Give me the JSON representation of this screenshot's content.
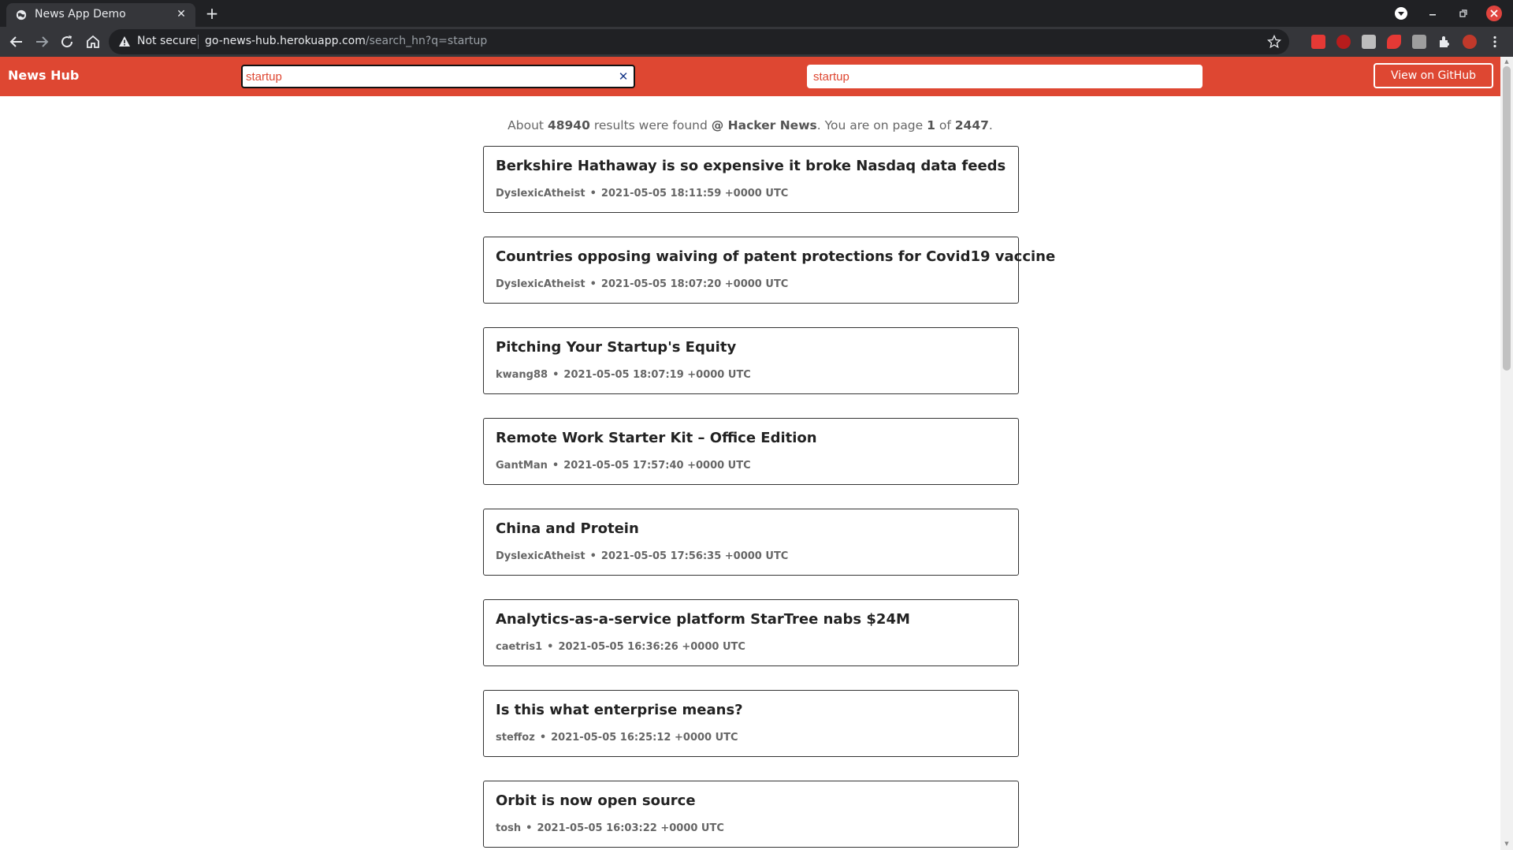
{
  "browser": {
    "tab_title": "News App Demo",
    "security_label": "Not secure",
    "url_host": "go-news-hub.herokuapp.com",
    "url_path": "/search_hn?q=startup"
  },
  "navbar": {
    "brand": "News Hub",
    "search_value": "startup",
    "search_value_2": "startup",
    "github_label": "View on GitHub"
  },
  "summary": {
    "prefix": "About",
    "count": "48940",
    "mid": "results were found",
    "source": "@ Hacker News",
    "page_text": ". You are on page",
    "page": "1",
    "of": "of",
    "total_pages": "2447",
    "end": "."
  },
  "results": [
    {
      "title": "Berkshire Hathaway is so expensive it broke Nasdaq data feeds",
      "author": "DyslexicAtheist",
      "date": "2021-05-05 18:11:59 +0000 UTC"
    },
    {
      "title": "Countries opposing waiving of patent protections for Covid19 vaccine",
      "author": "DyslexicAtheist",
      "date": "2021-05-05 18:07:20 +0000 UTC"
    },
    {
      "title": "Pitching Your Startup's Equity",
      "author": "kwang88",
      "date": "2021-05-05 18:07:19 +0000 UTC"
    },
    {
      "title": "Remote Work Starter Kit – Office Edition",
      "author": "GantMan",
      "date": "2021-05-05 17:57:40 +0000 UTC"
    },
    {
      "title": "China and Protein",
      "author": "DyslexicAtheist",
      "date": "2021-05-05 17:56:35 +0000 UTC"
    },
    {
      "title": "Analytics-as-a-service platform StarTree nabs $24M",
      "author": "caetris1",
      "date": "2021-05-05 16:36:26 +0000 UTC"
    },
    {
      "title": "Is this what enterprise means?",
      "author": "steffoz",
      "date": "2021-05-05 16:25:12 +0000 UTC"
    },
    {
      "title": "Orbit is now open source",
      "author": "tosh",
      "date": "2021-05-05 16:03:22 +0000 UTC"
    }
  ],
  "colors": {
    "accent": "#de4732",
    "chrome_dark": "#202124",
    "chrome_toolbar": "#35363a"
  },
  "icons": [
    "globe-icon",
    "close-icon",
    "plus-icon",
    "back-icon",
    "forward-icon",
    "reload-icon",
    "home-icon",
    "warning-icon",
    "star-icon",
    "extensions-icon",
    "menu-icon"
  ]
}
